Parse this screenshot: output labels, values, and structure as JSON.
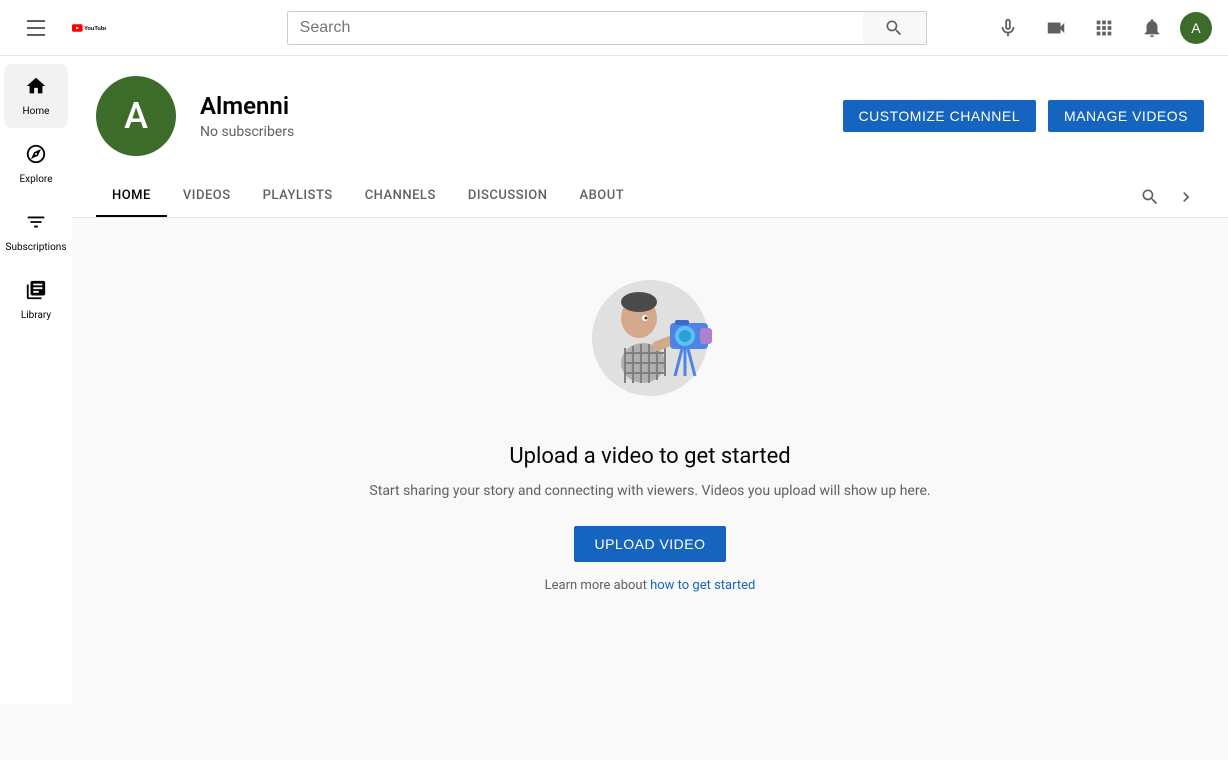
{
  "header": {
    "search_placeholder": "Search",
    "logo_text": "YouTube"
  },
  "sidebar": {
    "items": [
      {
        "id": "home",
        "label": "Home",
        "active": true
      },
      {
        "id": "explore",
        "label": "Explore",
        "active": false
      },
      {
        "id": "subscriptions",
        "label": "Subscriptions",
        "active": false
      },
      {
        "id": "library",
        "label": "Library",
        "active": false
      }
    ]
  },
  "channel": {
    "avatar_letter": "A",
    "name": "Almenni",
    "subscribers": "No subscribers",
    "customize_label": "CUSTOMIZE CHANNEL",
    "manage_label": "MANAGE VIDEOS",
    "tabs": [
      {
        "id": "home",
        "label": "HOME",
        "active": true
      },
      {
        "id": "videos",
        "label": "VIDEOS",
        "active": false
      },
      {
        "id": "playlists",
        "label": "PLAYLISTS",
        "active": false
      },
      {
        "id": "channels",
        "label": "CHANNELS",
        "active": false
      },
      {
        "id": "discussion",
        "label": "DISCUSSION",
        "active": false
      },
      {
        "id": "about",
        "label": "ABOUT",
        "active": false
      }
    ]
  },
  "empty_state": {
    "title": "Upload a video to get started",
    "subtitle": "Start sharing your story and connecting with viewers. Videos you upload will show up here.",
    "upload_label": "UPLOAD VIDEO",
    "learn_more_text": "Learn more about ",
    "learn_more_link_text": "how to get started"
  },
  "colors": {
    "accent": "#1565c0",
    "avatar_bg": "#3d6b2a",
    "text_primary": "#030303",
    "text_secondary": "#606060"
  }
}
